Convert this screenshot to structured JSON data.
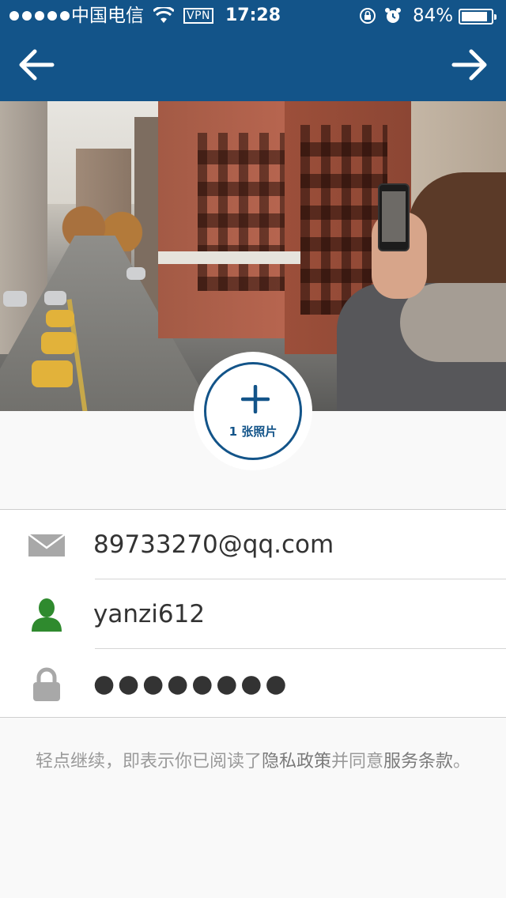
{
  "status_bar": {
    "carrier": "中国电信",
    "vpn": "VPN",
    "time": "17:28",
    "battery_percent": "84%",
    "battery_level": 0.84
  },
  "nav": {
    "back_icon": "arrow-left-icon",
    "next_icon": "arrow-right-icon"
  },
  "photo": {
    "add_icon": "plus-icon",
    "count_label": "1 张照片"
  },
  "form": {
    "email": {
      "icon": "envelope-icon",
      "value": "89733270@qq.com"
    },
    "username": {
      "icon": "person-icon",
      "value": "yanzi612"
    },
    "password": {
      "icon": "lock-icon",
      "value": "●●●●●●●●"
    }
  },
  "terms": {
    "prefix": "轻点继续，即表示你已阅读了",
    "privacy_link": "隐私政策",
    "middle": "并同意",
    "service_link": "服务条款",
    "suffix": "。"
  },
  "colors": {
    "header_blue": "#135489",
    "user_icon_green": "#2f8a2e",
    "icon_gray": "#a8a8a8"
  }
}
